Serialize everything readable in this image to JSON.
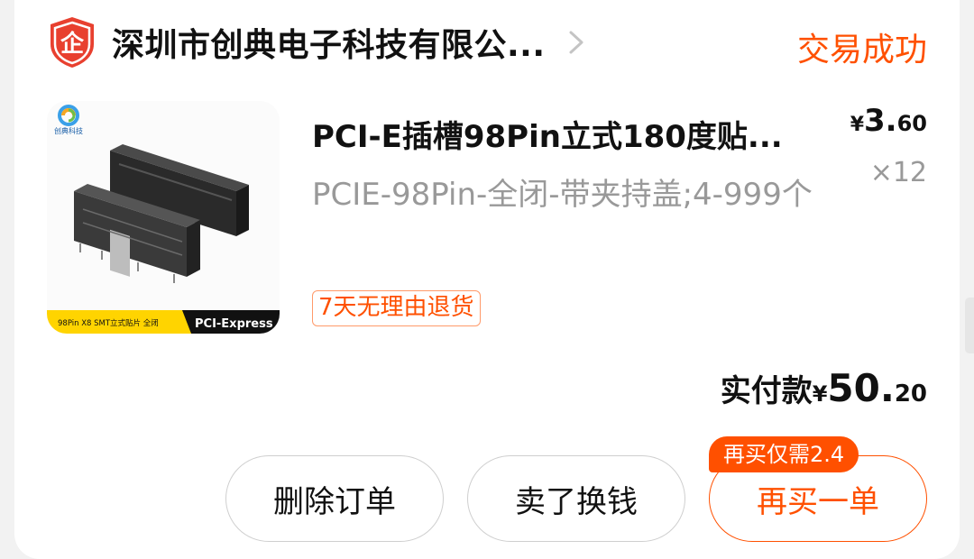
{
  "shop": {
    "name": "深圳市创典电子科技有限公...",
    "logo_char": "企",
    "status": "交易成功"
  },
  "product": {
    "title": "PCI-E插槽98Pin立式180度贴...",
    "spec": "PCIE-98Pin-全闭-带夹持盖;4-999个",
    "badge": "7天无理由退货",
    "price_symbol": "¥",
    "price_int": "3.",
    "price_dec": "60",
    "quantity": "×12",
    "image": {
      "brand": "创典科技",
      "caption_left": "98Pin X8 SMT立式贴片 全闭",
      "caption_right": "PCI-Express"
    }
  },
  "order": {
    "total_label": "实付款",
    "total_symbol": "¥",
    "total_int": "50.",
    "total_dec": "20"
  },
  "actions": {
    "delete": "删除订单",
    "sell": "卖了换钱",
    "rebuy": "再买一单",
    "rebuy_tip": "再买仅需2.4"
  },
  "colors": {
    "accent": "#ff5000",
    "shop_icon_red": "#e8402f"
  }
}
